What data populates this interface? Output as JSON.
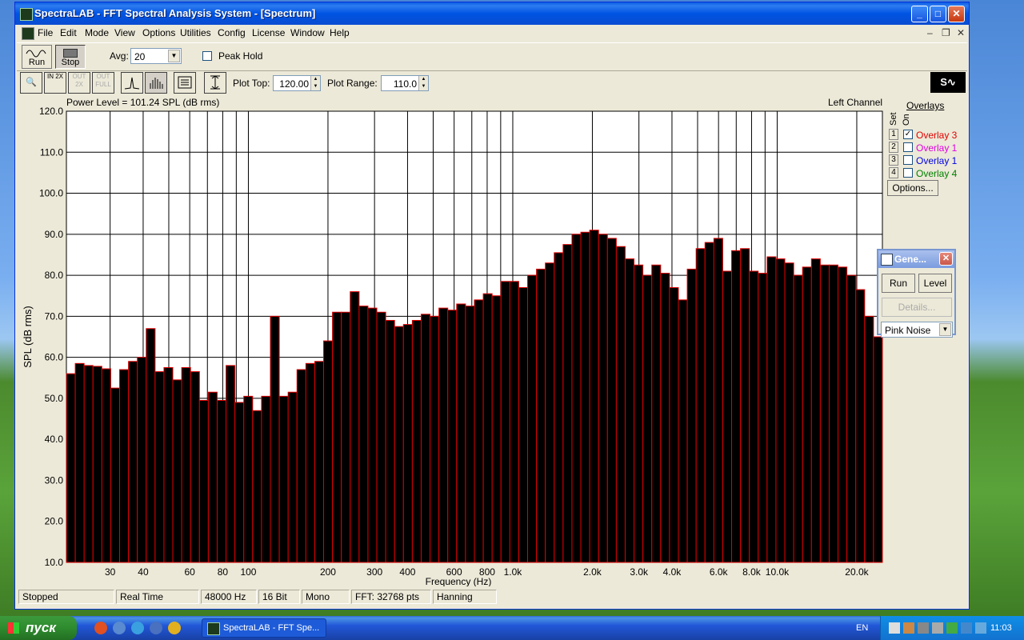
{
  "window": {
    "title": "SpectraLAB - FFT Spectral Analysis System - [Spectrum]"
  },
  "menu": [
    "File",
    "Edit",
    "Mode",
    "View",
    "Options",
    "Utilities",
    "Config",
    "License",
    "Window",
    "Help"
  ],
  "toolbar1": {
    "run_label": "Run",
    "stop_label": "Stop",
    "avg_label": "Avg:",
    "avg_value": "20",
    "peak_hold_label": "Peak Hold"
  },
  "toolbar2": {
    "buttons": [
      "zoom-icon",
      "zoom-in-2x-icon",
      "zoom-out-2x-icon",
      "zoom-out-full-icon",
      "line-plot-icon",
      "bar-plot-icon",
      "table-icon",
      "autoscale-icon"
    ],
    "zin_label": "IN 2X",
    "zout_label": "OUT 2X",
    "zfull_label": "OUT FULL",
    "plot_top_label": "Plot Top:",
    "plot_top_value": "120.00",
    "plot_range_label": "Plot Range:",
    "plot_range_value": "110.0"
  },
  "plot": {
    "power_level": "Power Level = 101.24 SPL (dB rms)",
    "channel": "Left Channel"
  },
  "overlays": {
    "title": "Overlays",
    "set_label": "Set",
    "on_label": "On",
    "rows": [
      {
        "num": "1",
        "checked": true,
        "name": "Overlay 3",
        "color": "#e00000"
      },
      {
        "num": "2",
        "checked": false,
        "name": "Overlay 1",
        "color": "#e000e0"
      },
      {
        "num": "3",
        "checked": false,
        "name": "Overlay 1",
        "color": "#0000e0"
      },
      {
        "num": "4",
        "checked": false,
        "name": "Overlay 4",
        "color": "#008000"
      }
    ],
    "options_label": "Options..."
  },
  "generator": {
    "title": "Gene...",
    "run_label": "Run",
    "level_label": "Level",
    "details_label": "Details...",
    "signal_value": "Pink Noise"
  },
  "status": [
    "Stopped",
    "Real Time",
    "48000 Hz",
    "16 Bit",
    "Mono",
    "FFT: 32768 pts",
    "Hanning"
  ],
  "taskbar": {
    "start_label": "пуск",
    "task_label": "SpectraLAB - FFT Spe...",
    "lang": "EN",
    "clock": "11:03"
  },
  "chart_data": {
    "type": "bar",
    "xlabel": "Frequency (Hz)",
    "ylabel": "SPL (dB rms)",
    "ylim": [
      10,
      120
    ],
    "y_ticks": [
      "120.0",
      "110.0",
      "100.0",
      "90.0",
      "80.0",
      "70.0",
      "60.0",
      "50.0",
      "40.0",
      "30.0",
      "20.0",
      "10.0"
    ],
    "x_scale": "log",
    "xlim": [
      20.5,
      25000
    ],
    "x_ticks": [
      {
        "f": 30,
        "label": "30"
      },
      {
        "f": 40,
        "label": "40"
      },
      {
        "f": 60,
        "label": "60"
      },
      {
        "f": 80,
        "label": "80"
      },
      {
        "f": 100,
        "label": "100"
      },
      {
        "f": 200,
        "label": "200"
      },
      {
        "f": 300,
        "label": "300"
      },
      {
        "f": 400,
        "label": "400"
      },
      {
        "f": 600,
        "label": "600"
      },
      {
        "f": 800,
        "label": "800"
      },
      {
        "f": 1000,
        "label": "1.0k"
      },
      {
        "f": 2000,
        "label": "2.0k"
      },
      {
        "f": 3000,
        "label": "3.0k"
      },
      {
        "f": 4000,
        "label": "4.0k"
      },
      {
        "f": 6000,
        "label": "6.0k"
      },
      {
        "f": 8000,
        "label": "8.0k"
      },
      {
        "f": 10000,
        "label": "10.0k"
      },
      {
        "f": 20000,
        "label": "20.0k"
      }
    ],
    "minor_gridlines_hz": [
      50,
      70,
      90,
      500,
      700,
      900,
      5000,
      7000,
      9000
    ],
    "bar_color": "#000000",
    "bar_edge_color": "#e00000",
    "values": [
      56,
      58.5,
      58,
      57.8,
      57.2,
      52.5,
      57,
      59,
      60,
      67,
      56.5,
      57.5,
      54.5,
      57.5,
      56.5,
      49.5,
      51.5,
      49.5,
      58,
      49,
      50.5,
      47,
      50.5,
      70,
      50.5,
      51.5,
      57,
      58.5,
      59,
      64,
      71,
      71,
      76,
      72.5,
      72,
      71,
      69,
      67.5,
      68,
      69,
      70.5,
      70,
      72,
      71.5,
      73,
      72.5,
      74,
      75.5,
      75,
      78.5,
      78.5,
      77,
      80,
      81.5,
      83,
      85.5,
      87.5,
      90,
      90.5,
      91,
      90,
      89,
      87,
      84,
      82.5,
      80,
      82.5,
      80.5,
      77,
      74,
      81.5,
      86.5,
      88,
      89,
      81,
      86,
      86.5,
      81,
      80.5,
      84.5,
      84,
      83,
      80,
      82,
      84,
      82.5,
      82.5,
      82,
      80,
      76.5,
      70,
      65
    ]
  }
}
